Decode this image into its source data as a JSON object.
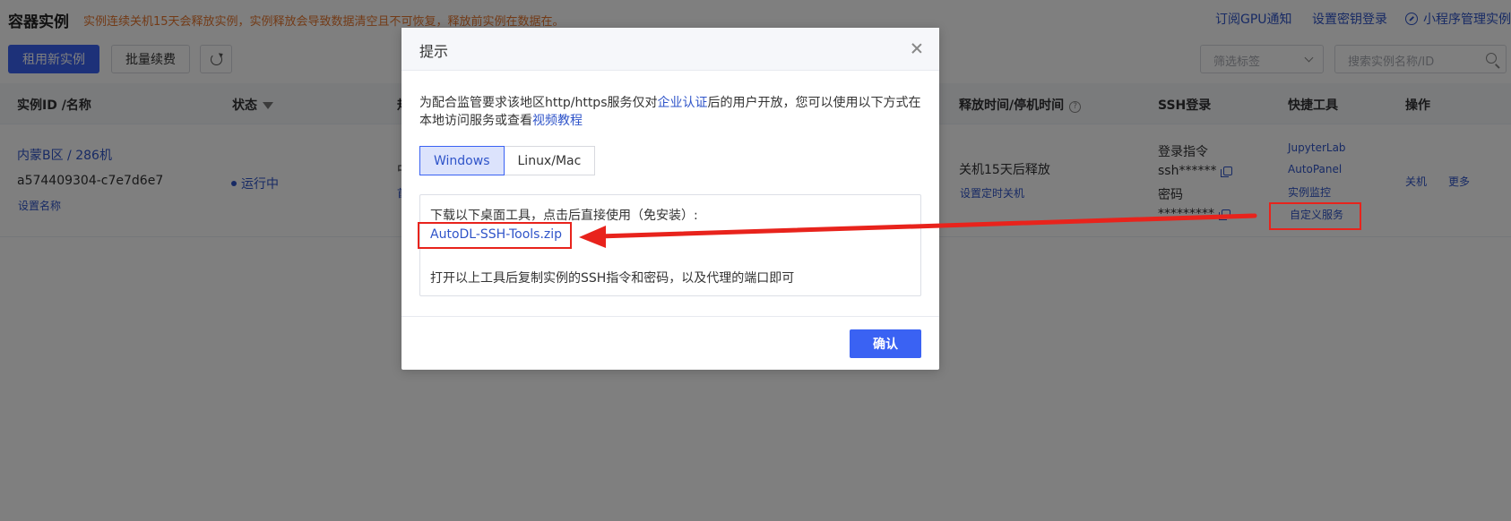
{
  "header": {
    "title": "容器实例",
    "warning": "实例连续关机15天会释放实例，实例释放会导致数据清空且不可恢复，释放前实例在数据在。",
    "links": [
      "订阅GPU通知",
      "设置密钥登录",
      "小程序管理实例"
    ]
  },
  "toolbar": {
    "rent_label": "租用新实例",
    "renew_label": "批量续费",
    "filter_placeholder": "筛选标签",
    "search_placeholder": "搜索实例名称/ID"
  },
  "table": {
    "headers": [
      "实例ID /名称",
      "状态",
      "规",
      "释放时间/停机时间",
      "SSH登录",
      "快捷工具",
      "操作"
    ],
    "row": {
      "region": "内蒙B区 / 286机",
      "instance_id": "a574409304-c7e7d6e7",
      "set_name": "设置名称",
      "status": "运行中",
      "spec_partial_1": "中",
      "spec_partial_2": "首",
      "release": "关机15天后释放",
      "set_timer": "设置定时关机",
      "ssh_cmd_label": "登录指令",
      "ssh_cmd": "ssh******",
      "pwd_label": "密码",
      "pwd": "*********",
      "tools": [
        "JupyterLab",
        "AutoPanel",
        "实例监控",
        "自定义服务"
      ],
      "actions": [
        "关机",
        "更多"
      ]
    }
  },
  "modal": {
    "title": "提示",
    "desc_before": "为配合监管要求该地区http/https服务仅对",
    "desc_link1": "企业认证",
    "desc_middle": "后的用户开放，您可以使用以下方式在本地访问服务或查看",
    "desc_link2": "视频教程",
    "tabs": [
      "Windows",
      "Linux/Mac"
    ],
    "content_line1": "下载以下桌面工具，点击后直接使用（免安装）:",
    "zip_link": "AutoDL-SSH-Tools.zip",
    "content_line3": "打开以上工具后复制实例的SSH指令和密码，以及代理的端口即可",
    "confirm_label": "确认"
  },
  "colors": {
    "primary": "#3a62f3",
    "link": "#2f54c9",
    "warning": "#e6762e",
    "annotation": "#e8231c"
  }
}
